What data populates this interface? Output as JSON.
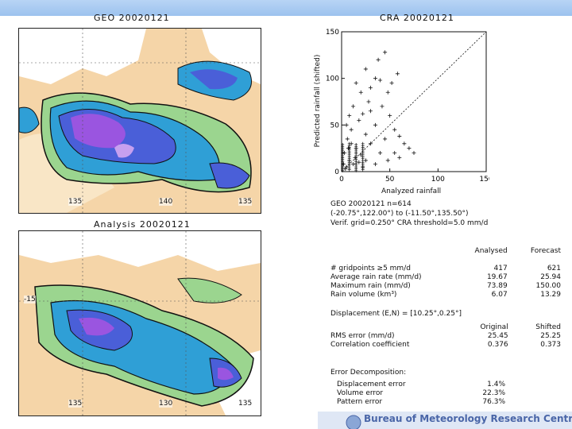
{
  "geo_panel": {
    "title": "GEO    20020121",
    "tick_left": "135",
    "tick_mid": "140",
    "tick_right": "135"
  },
  "analysis_panel": {
    "title": "Analysis  20020121",
    "tick_lat": "-15",
    "tick_left": "135",
    "tick_mid": "130",
    "tick_right": "135"
  },
  "chart_data": {
    "type": "scatter",
    "title": "CRA   20020121",
    "xlabel": "Analyzed rainfall",
    "ylabel": "Predicted rainfall (shifted)",
    "xlim": [
      0,
      150
    ],
    "ylim": [
      0,
      150
    ],
    "x_ticks": [
      "0",
      "50",
      "100",
      "150"
    ],
    "y_ticks": [
      "0",
      "50",
      "100",
      "150"
    ],
    "diagonal": true,
    "points": [
      [
        5,
        5
      ],
      [
        8,
        12
      ],
      [
        3,
        20
      ],
      [
        12,
        8
      ],
      [
        15,
        25
      ],
      [
        20,
        18
      ],
      [
        6,
        35
      ],
      [
        10,
        45
      ],
      [
        25,
        40
      ],
      [
        30,
        30
      ],
      [
        18,
        55
      ],
      [
        22,
        62
      ],
      [
        35,
        50
      ],
      [
        40,
        20
      ],
      [
        45,
        35
      ],
      [
        12,
        70
      ],
      [
        28,
        75
      ],
      [
        20,
        85
      ],
      [
        15,
        95
      ],
      [
        30,
        90
      ],
      [
        25,
        110
      ],
      [
        38,
        120
      ],
      [
        45,
        128
      ],
      [
        40,
        98
      ],
      [
        50,
        60
      ],
      [
        55,
        45
      ],
      [
        60,
        38
      ],
      [
        65,
        30
      ],
      [
        70,
        25
      ],
      [
        75,
        20
      ],
      [
        48,
        85
      ],
      [
        52,
        95
      ],
      [
        58,
        105
      ],
      [
        35,
        100
      ],
      [
        42,
        70
      ],
      [
        30,
        65
      ],
      [
        8,
        60
      ],
      [
        5,
        50
      ],
      [
        10,
        30
      ],
      [
        14,
        15
      ],
      [
        2,
        8
      ],
      [
        4,
        3
      ],
      [
        7,
        25
      ],
      [
        18,
        10
      ],
      [
        22,
        5
      ],
      [
        60,
        15
      ],
      [
        55,
        20
      ],
      [
        48,
        12
      ],
      [
        35,
        8
      ],
      [
        25,
        12
      ]
    ]
  },
  "info": {
    "line1": "GEO 20020121  n=614",
    "line2": "(-20.75°,122.00°) to (-11.50°,135.50°)",
    "line3": "Verif. grid=0.250°  CRA threshold=5.0 mm/d"
  },
  "stats": {
    "headers": [
      "Analysed",
      "Forecast"
    ],
    "rows": [
      {
        "label": "# gridpoints ≥5 mm/d",
        "a": "417",
        "f": "621"
      },
      {
        "label": "Average rain rate (mm/d)",
        "a": "19.67",
        "f": "25.94"
      },
      {
        "label": "Maximum rain (mm/d)",
        "a": "73.89",
        "f": "150.00"
      },
      {
        "label": "Rain volume (km³)",
        "a": "6.07",
        "f": "13.29"
      }
    ],
    "displacement": "Displacement (E,N) = [10.25°,0.25°]",
    "headers2": [
      "Original",
      "Shifted"
    ],
    "rows2": [
      {
        "label": "RMS error (mm/d)",
        "a": "25.45",
        "f": "25.25"
      },
      {
        "label": "Correlation coefficient",
        "a": "0.376",
        "f": "0.373"
      }
    ],
    "decomp_title": "Error Decomposition:",
    "decomp": [
      {
        "label": "Displacement error",
        "v": "1.4%"
      },
      {
        "label": "Volume error",
        "v": "22.3%"
      },
      {
        "label": "Pattern error",
        "v": "76.3%"
      }
    ]
  },
  "footer": {
    "text": "Bureau of Meteorology Research Centre"
  }
}
